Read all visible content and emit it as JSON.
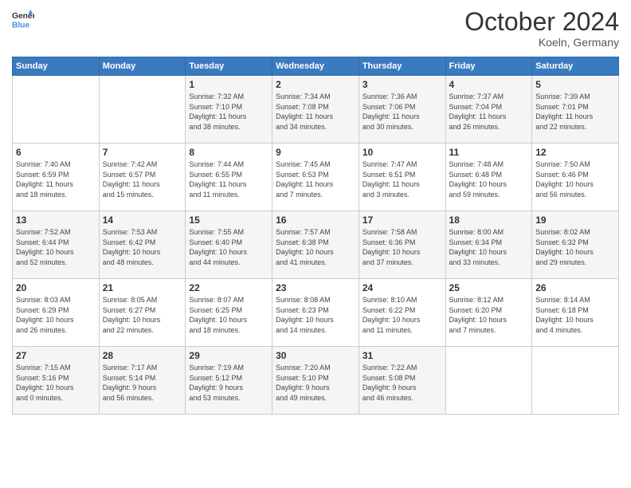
{
  "header": {
    "logo_line1": "General",
    "logo_line2": "Blue",
    "month": "October 2024",
    "location": "Koeln, Germany"
  },
  "weekdays": [
    "Sunday",
    "Monday",
    "Tuesday",
    "Wednesday",
    "Thursday",
    "Friday",
    "Saturday"
  ],
  "weeks": [
    [
      {
        "day": "",
        "content": ""
      },
      {
        "day": "",
        "content": ""
      },
      {
        "day": "1",
        "content": "Sunrise: 7:32 AM\nSunset: 7:10 PM\nDaylight: 11 hours\nand 38 minutes."
      },
      {
        "day": "2",
        "content": "Sunrise: 7:34 AM\nSunset: 7:08 PM\nDaylight: 11 hours\nand 34 minutes."
      },
      {
        "day": "3",
        "content": "Sunrise: 7:36 AM\nSunset: 7:06 PM\nDaylight: 11 hours\nand 30 minutes."
      },
      {
        "day": "4",
        "content": "Sunrise: 7:37 AM\nSunset: 7:04 PM\nDaylight: 11 hours\nand 26 minutes."
      },
      {
        "day": "5",
        "content": "Sunrise: 7:39 AM\nSunset: 7:01 PM\nDaylight: 11 hours\nand 22 minutes."
      }
    ],
    [
      {
        "day": "6",
        "content": "Sunrise: 7:40 AM\nSunset: 6:59 PM\nDaylight: 11 hours\nand 18 minutes."
      },
      {
        "day": "7",
        "content": "Sunrise: 7:42 AM\nSunset: 6:57 PM\nDaylight: 11 hours\nand 15 minutes."
      },
      {
        "day": "8",
        "content": "Sunrise: 7:44 AM\nSunset: 6:55 PM\nDaylight: 11 hours\nand 11 minutes."
      },
      {
        "day": "9",
        "content": "Sunrise: 7:45 AM\nSunset: 6:53 PM\nDaylight: 11 hours\nand 7 minutes."
      },
      {
        "day": "10",
        "content": "Sunrise: 7:47 AM\nSunset: 6:51 PM\nDaylight: 11 hours\nand 3 minutes."
      },
      {
        "day": "11",
        "content": "Sunrise: 7:48 AM\nSunset: 6:48 PM\nDaylight: 10 hours\nand 59 minutes."
      },
      {
        "day": "12",
        "content": "Sunrise: 7:50 AM\nSunset: 6:46 PM\nDaylight: 10 hours\nand 56 minutes."
      }
    ],
    [
      {
        "day": "13",
        "content": "Sunrise: 7:52 AM\nSunset: 6:44 PM\nDaylight: 10 hours\nand 52 minutes."
      },
      {
        "day": "14",
        "content": "Sunrise: 7:53 AM\nSunset: 6:42 PM\nDaylight: 10 hours\nand 48 minutes."
      },
      {
        "day": "15",
        "content": "Sunrise: 7:55 AM\nSunset: 6:40 PM\nDaylight: 10 hours\nand 44 minutes."
      },
      {
        "day": "16",
        "content": "Sunrise: 7:57 AM\nSunset: 6:38 PM\nDaylight: 10 hours\nand 41 minutes."
      },
      {
        "day": "17",
        "content": "Sunrise: 7:58 AM\nSunset: 6:36 PM\nDaylight: 10 hours\nand 37 minutes."
      },
      {
        "day": "18",
        "content": "Sunrise: 8:00 AM\nSunset: 6:34 PM\nDaylight: 10 hours\nand 33 minutes."
      },
      {
        "day": "19",
        "content": "Sunrise: 8:02 AM\nSunset: 6:32 PM\nDaylight: 10 hours\nand 29 minutes."
      }
    ],
    [
      {
        "day": "20",
        "content": "Sunrise: 8:03 AM\nSunset: 6:29 PM\nDaylight: 10 hours\nand 26 minutes."
      },
      {
        "day": "21",
        "content": "Sunrise: 8:05 AM\nSunset: 6:27 PM\nDaylight: 10 hours\nand 22 minutes."
      },
      {
        "day": "22",
        "content": "Sunrise: 8:07 AM\nSunset: 6:25 PM\nDaylight: 10 hours\nand 18 minutes."
      },
      {
        "day": "23",
        "content": "Sunrise: 8:08 AM\nSunset: 6:23 PM\nDaylight: 10 hours\nand 14 minutes."
      },
      {
        "day": "24",
        "content": "Sunrise: 8:10 AM\nSunset: 6:22 PM\nDaylight: 10 hours\nand 11 minutes."
      },
      {
        "day": "25",
        "content": "Sunrise: 8:12 AM\nSunset: 6:20 PM\nDaylight: 10 hours\nand 7 minutes."
      },
      {
        "day": "26",
        "content": "Sunrise: 8:14 AM\nSunset: 6:18 PM\nDaylight: 10 hours\nand 4 minutes."
      }
    ],
    [
      {
        "day": "27",
        "content": "Sunrise: 7:15 AM\nSunset: 5:16 PM\nDaylight: 10 hours\nand 0 minutes."
      },
      {
        "day": "28",
        "content": "Sunrise: 7:17 AM\nSunset: 5:14 PM\nDaylight: 9 hours\nand 56 minutes."
      },
      {
        "day": "29",
        "content": "Sunrise: 7:19 AM\nSunset: 5:12 PM\nDaylight: 9 hours\nand 53 minutes."
      },
      {
        "day": "30",
        "content": "Sunrise: 7:20 AM\nSunset: 5:10 PM\nDaylight: 9 hours\nand 49 minutes."
      },
      {
        "day": "31",
        "content": "Sunrise: 7:22 AM\nSunset: 5:08 PM\nDaylight: 9 hours\nand 46 minutes."
      },
      {
        "day": "",
        "content": ""
      },
      {
        "day": "",
        "content": ""
      }
    ]
  ]
}
